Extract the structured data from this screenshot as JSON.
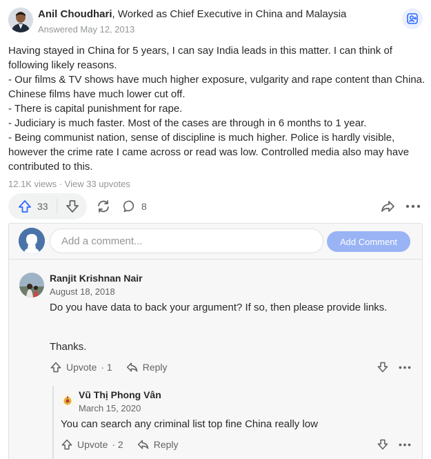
{
  "answer": {
    "author": "Anil Choudhari",
    "credential": ", Worked as Chief Executive in China and Malaysia",
    "answered": "Answered May 12, 2013",
    "paragraphs": [
      "Having stayed in China for 5 years, I can say India leads in this matter. I can think of following likely reasons.",
      "- Our films & TV shows have much higher exposure, vulgarity and rape content than China. Chinese films have much lower cut off.",
      "- There is capital punishment for rape.",
      "- Judiciary is much faster. Most of the cases are through in 6 months to 1 year.",
      "- Being communist nation, sense of discipline is much higher. Police is hardly visible, however the crime rate I came across or read was low. Controlled media also may have contributed to this."
    ],
    "views": "12.1K views",
    "separator": " · ",
    "upvotes_link": "View 33 upvotes"
  },
  "actions": {
    "upvote_count": "33",
    "comment_count": "8",
    "icons": {
      "upvote": "arrow-up-icon",
      "downvote": "arrow-down-icon",
      "share": "share-cycle-icon",
      "comment": "speech-bubble-icon",
      "forward": "forward-arrow-icon",
      "more": "more-dots-icon",
      "follow": "follow-user-icon"
    },
    "accent": "#2e69ff"
  },
  "composer": {
    "placeholder": "Add a comment...",
    "button": "Add Comment"
  },
  "comments": [
    {
      "author": "Ranjit Krishnan Nair",
      "date": "August 18, 2018",
      "text_lines": [
        "Do you have data to back your argument? If so, then please provide links.",
        "Thanks."
      ],
      "upvote_label": "Upvote",
      "upvote_count": "· 1",
      "reply_label": "Reply"
    },
    {
      "author": "Vũ Thị Phong Vân",
      "date": "March 15, 2020",
      "text_lines": [
        "You can search any criminal list top fine China really low"
      ],
      "upvote_label": "Upvote",
      "upvote_count": "· 2",
      "reply_label": "Reply"
    }
  ]
}
